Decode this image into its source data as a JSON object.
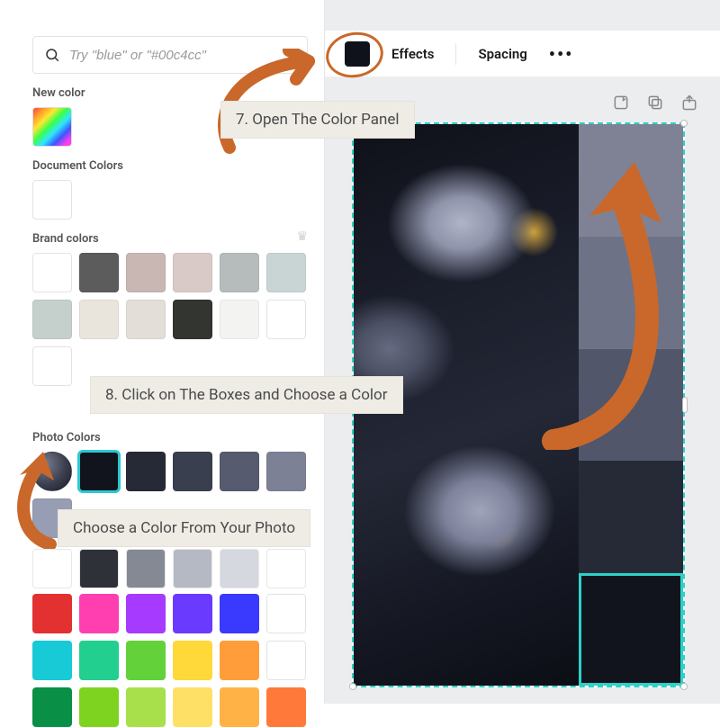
{
  "search": {
    "placeholder": "Try \"blue\" or \"#00c4cc\""
  },
  "sections": {
    "new_color": "New color",
    "document_colors": "Document Colors",
    "brand_colors": "Brand colors",
    "photo_colors": "Photo Colors"
  },
  "toolbar": {
    "effects": "Effects",
    "spacing": "Spacing",
    "color_chip": "#0f121a"
  },
  "brand_colors": {
    "row1": [
      "#ffffff",
      "#5c5c5c",
      "#c8b7b3",
      "#d9cac7",
      "#b6bcbc",
      "#c9d4d5"
    ],
    "row2": [
      "#c5cfcb",
      "#e9e4dc",
      "#e3ded7",
      "#323530",
      "#f3f3f1",
      "#ffffff"
    ],
    "row3": [
      "#ffffff"
    ]
  },
  "photo_colors": [
    "#11141c",
    "#262a36",
    "#3a3f50",
    "#565b6f",
    "#7c8196",
    "#979db3"
  ],
  "photo_colors_selected_index": 1,
  "default_colors": [
    [
      "#e33131",
      "#ff3fb0",
      "#a63aff",
      "#6b3aff",
      "#3a3aff",
      "#ffffff"
    ],
    [
      "#18c9d6",
      "#22cf8f",
      "#63d13a",
      "#ffd83a",
      "#ff9d3a",
      "#ffffff"
    ],
    [
      "#0a8f46",
      "#7ed321",
      "#a7e04b",
      "#ffe066",
      "#ffb347",
      "#ff7a3a"
    ]
  ],
  "canvas_palette": [
    {
      "color": "#7e8294",
      "selected": false
    },
    {
      "color": "#6e7286",
      "selected": false
    },
    {
      "color": "#51566a",
      "selected": false
    },
    {
      "color": "#262a36",
      "selected": false
    },
    {
      "color": "#11141c",
      "selected": true
    }
  ],
  "annotations": {
    "open_panel": "7. Open The Color Panel",
    "click_boxes": "8.  Click on The Boxes and Choose a Color",
    "choose_photo": "Choose a Color From Your Photo"
  },
  "icons": {
    "search": "search-icon",
    "crown": "crown-icon",
    "notes": "notes-icon",
    "copy": "copy-icon",
    "share": "share-icon",
    "more": "more-icon"
  },
  "accent": "#c9682a"
}
